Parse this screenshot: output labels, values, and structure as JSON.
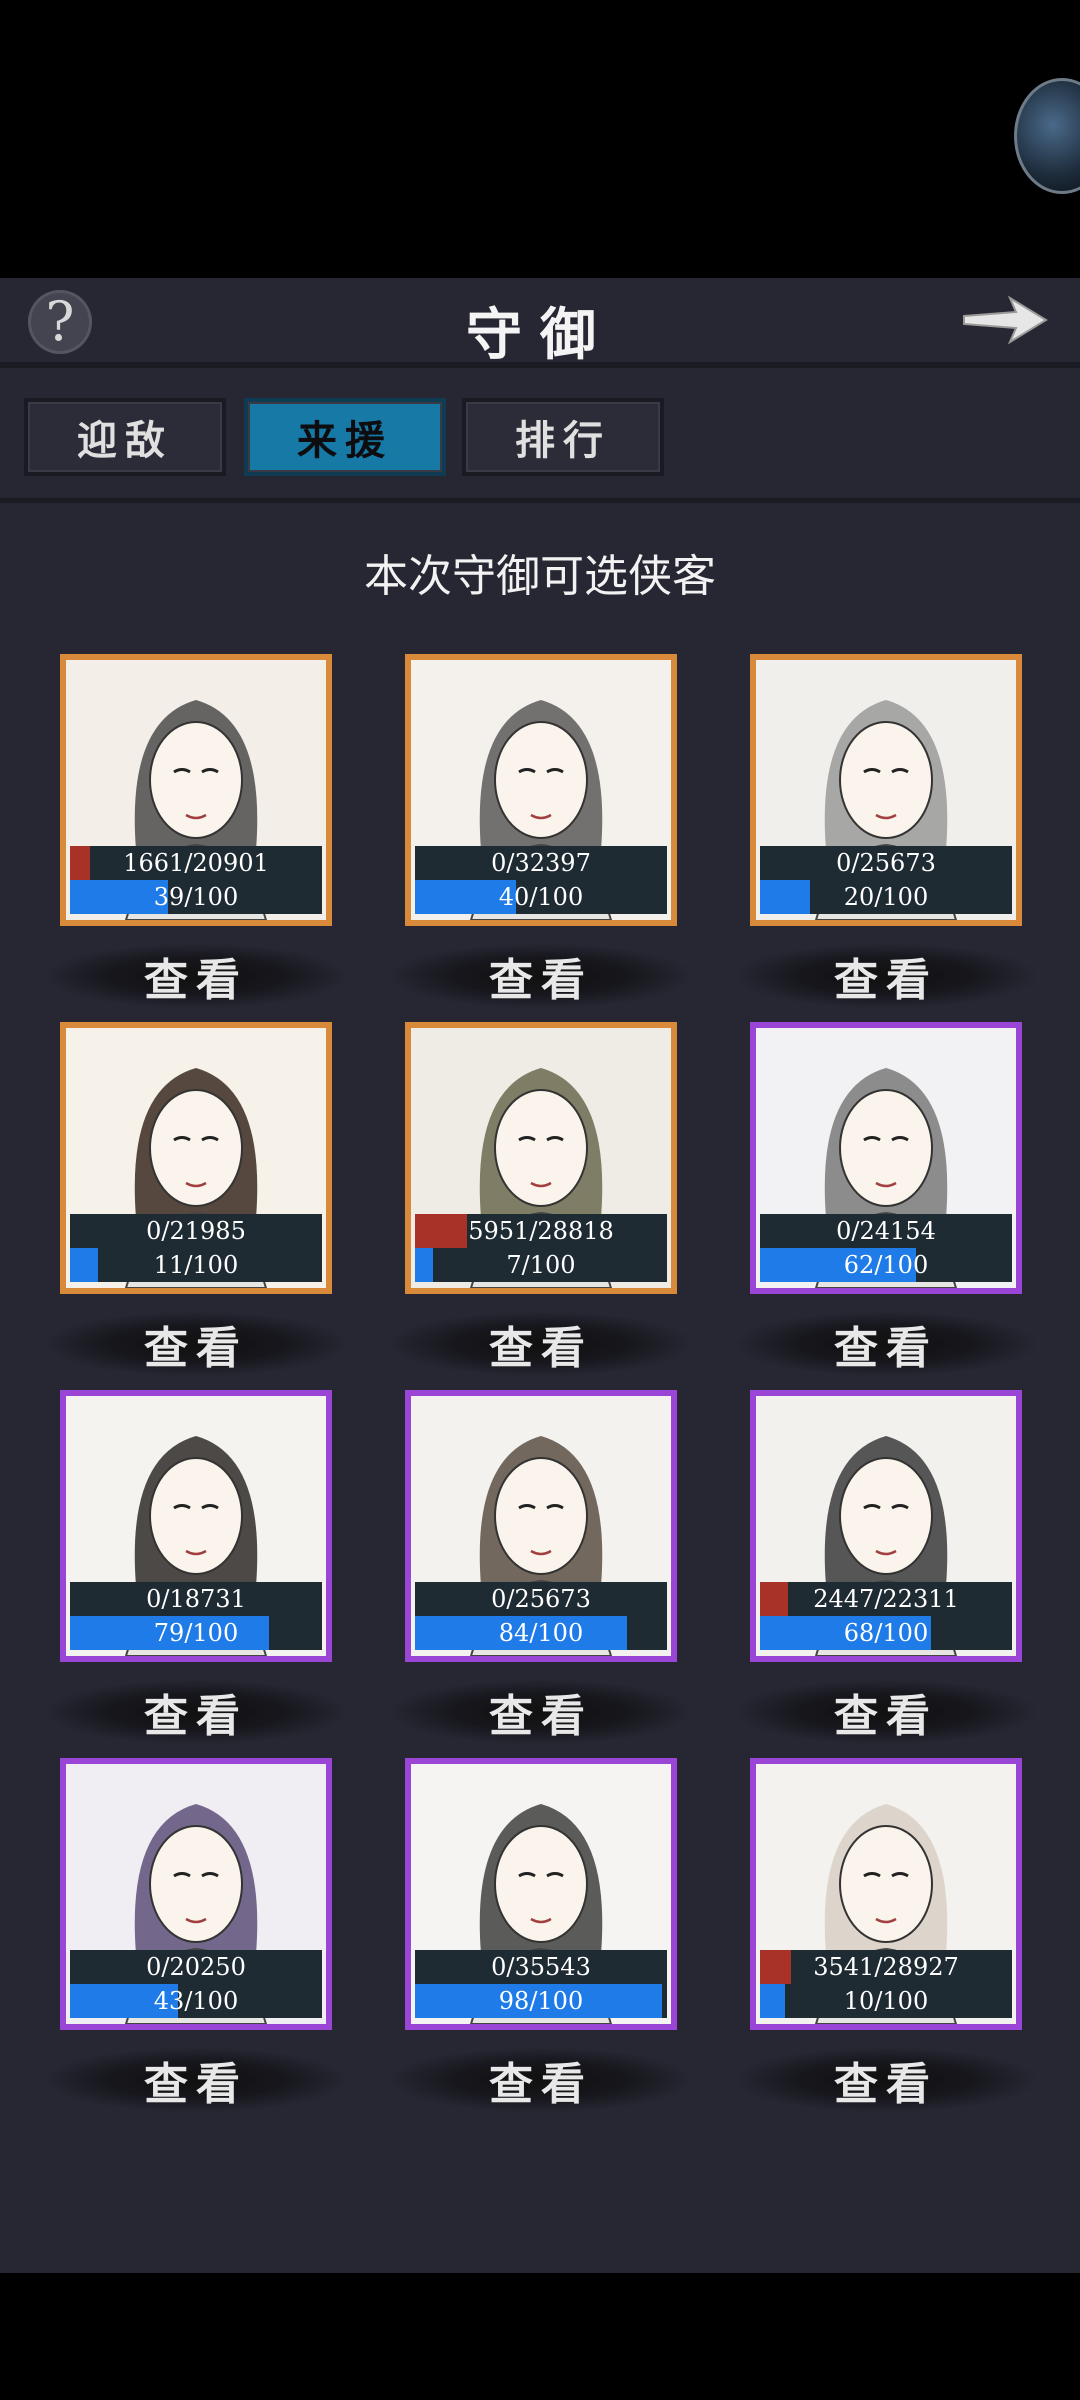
{
  "header": {
    "title": "守御"
  },
  "tabs": [
    {
      "label": "迎敌",
      "active": false
    },
    {
      "label": "来援",
      "active": true
    },
    {
      "label": "排行",
      "active": false
    }
  ],
  "section_label": "本次守御可选侠客",
  "view_label": "查看",
  "colors": {
    "orange_frame": "#d9893a",
    "purple_frame": "#9a45d6",
    "hp": "#a83228",
    "mp": "#1e7be8",
    "tab_active": "#1679a6"
  },
  "heroes": [
    {
      "hp": "1661/20901",
      "hp_ratio": 0.079,
      "mp": "39/100",
      "mp_ratio": 0.39,
      "rarity": "orange"
    },
    {
      "hp": "0/32397",
      "hp_ratio": 0,
      "mp": "40/100",
      "mp_ratio": 0.4,
      "rarity": "orange"
    },
    {
      "hp": "0/25673",
      "hp_ratio": 0,
      "mp": "20/100",
      "mp_ratio": 0.2,
      "rarity": "orange"
    },
    {
      "hp": "0/21985",
      "hp_ratio": 0,
      "mp": "11/100",
      "mp_ratio": 0.11,
      "rarity": "orange"
    },
    {
      "hp": "5951/28818",
      "hp_ratio": 0.206,
      "mp": "7/100",
      "mp_ratio": 0.07,
      "rarity": "orange"
    },
    {
      "hp": "0/24154",
      "hp_ratio": 0,
      "mp": "62/100",
      "mp_ratio": 0.62,
      "rarity": "purple"
    },
    {
      "hp": "0/18731",
      "hp_ratio": 0,
      "mp": "79/100",
      "mp_ratio": 0.79,
      "rarity": "purple"
    },
    {
      "hp": "0/25673",
      "hp_ratio": 0,
      "mp": "84/100",
      "mp_ratio": 0.84,
      "rarity": "purple"
    },
    {
      "hp": "2447/22311",
      "hp_ratio": 0.11,
      "mp": "68/100",
      "mp_ratio": 0.68,
      "rarity": "purple"
    },
    {
      "hp": "0/20250",
      "hp_ratio": 0,
      "mp": "43/100",
      "mp_ratio": 0.43,
      "rarity": "purple"
    },
    {
      "hp": "0/35543",
      "hp_ratio": 0,
      "mp": "98/100",
      "mp_ratio": 0.98,
      "rarity": "purple"
    },
    {
      "hp": "3541/28927",
      "hp_ratio": 0.122,
      "mp": "10/100",
      "mp_ratio": 0.1,
      "rarity": "purple"
    }
  ]
}
